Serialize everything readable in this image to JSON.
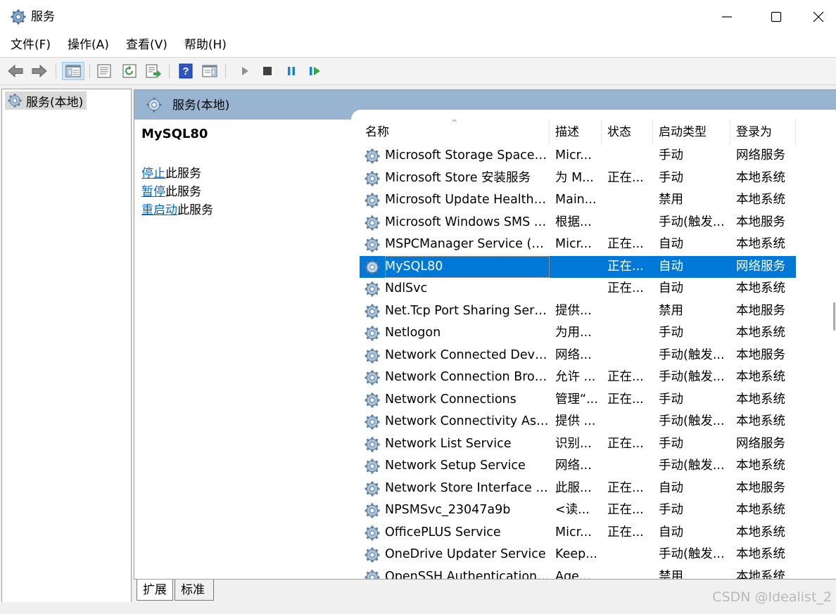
{
  "window": {
    "title": "服务"
  },
  "menu": [
    {
      "label": "文件(F)"
    },
    {
      "label": "操作(A)"
    },
    {
      "label": "查看(V)"
    },
    {
      "label": "帮助(H)"
    }
  ],
  "tree": {
    "item": "服务(本地)"
  },
  "pane": {
    "header": "服务(本地)"
  },
  "details": {
    "service_name": "MySQL80",
    "actions": [
      {
        "link": "停止",
        "rest": "此服务"
      },
      {
        "link": "暂停",
        "rest": "此服务"
      },
      {
        "link": "重启动",
        "rest": "此服务"
      }
    ]
  },
  "columns": {
    "name": "名称",
    "description": "描述",
    "status": "状态",
    "startup": "启动类型",
    "logon": "登录为"
  },
  "sort_indicator": "^",
  "rows": [
    {
      "name": "Microsoft Storage Spaces S...",
      "description": "Micr...",
      "status": "",
      "startup": "手动",
      "logon": "网络服务"
    },
    {
      "name": "Microsoft Store 安装服务",
      "description": "为 M...",
      "status": "正在...",
      "startup": "手动",
      "logon": "本地系统"
    },
    {
      "name": "Microsoft Update Health S...",
      "description": "Main...",
      "status": "",
      "startup": "禁用",
      "logon": "本地系统"
    },
    {
      "name": "Microsoft Windows SMS 路...",
      "description": "根据...",
      "status": "",
      "startup": "手动(触发...",
      "logon": "本地服务"
    },
    {
      "name": "MSPCManager Service (St...",
      "description": "Micr...",
      "status": "正在...",
      "startup": "自动",
      "logon": "本地系统"
    },
    {
      "name": "MySQL80",
      "description": "",
      "status": "正在...",
      "startup": "自动",
      "logon": "网络服务",
      "selected": true
    },
    {
      "name": "NdlSvc",
      "description": "",
      "status": "正在...",
      "startup": "自动",
      "logon": "本地系统"
    },
    {
      "name": "Net.Tcp Port Sharing Service",
      "description": "提供...",
      "status": "",
      "startup": "禁用",
      "logon": "本地服务"
    },
    {
      "name": "Netlogon",
      "description": "为用...",
      "status": "",
      "startup": "手动",
      "logon": "本地系统"
    },
    {
      "name": "Network Connected Devic...",
      "description": "网络...",
      "status": "",
      "startup": "手动(触发...",
      "logon": "本地服务"
    },
    {
      "name": "Network Connection Broker",
      "description": "允许 ...",
      "status": "正在...",
      "startup": "手动(触发...",
      "logon": "本地系统"
    },
    {
      "name": "Network Connections",
      "description": "管理“...",
      "status": "正在...",
      "startup": "手动",
      "logon": "本地系统"
    },
    {
      "name": "Network Connectivity Assis...",
      "description": "提供 ...",
      "status": "",
      "startup": "手动(触发...",
      "logon": "本地系统"
    },
    {
      "name": "Network List Service",
      "description": "识别...",
      "status": "正在...",
      "startup": "手动",
      "logon": "网络服务"
    },
    {
      "name": "Network Setup Service",
      "description": "网络...",
      "status": "",
      "startup": "手动(触发...",
      "logon": "本地系统"
    },
    {
      "name": "Network Store Interface Se...",
      "description": "此服...",
      "status": "正在...",
      "startup": "自动",
      "logon": "本地服务"
    },
    {
      "name": "NPSMSvc_23047a9b",
      "description": "<读...",
      "status": "正在...",
      "startup": "手动",
      "logon": "本地系统"
    },
    {
      "name": "OfficePLUS Service",
      "description": "Micr...",
      "status": "正在...",
      "startup": "自动",
      "logon": "本地系统"
    },
    {
      "name": "OneDrive Updater Service",
      "description": "Keep...",
      "status": "",
      "startup": "手动(触发...",
      "logon": "本地系统"
    },
    {
      "name": "OpenSSH Authentication ...",
      "description": "Age...",
      "status": "",
      "startup": "禁用",
      "logon": "本地系统"
    }
  ],
  "tabs": [
    {
      "label": "扩展",
      "active": true
    },
    {
      "label": "标准",
      "active": false
    }
  ],
  "watermark": "CSDN @Idealist_2",
  "colors": {
    "selection": "#0078d7",
    "pane_header": "#99b4d1",
    "link": "#0066cc"
  },
  "icons": {
    "app": "gear-icon",
    "toolbar": [
      "back-arrow-icon",
      "forward-arrow-icon",
      "console-tree-icon",
      "properties-icon",
      "refresh-icon",
      "export-list-icon",
      "help-icon",
      "show-pane-icon",
      "start-icon",
      "stop-icon",
      "pause-icon",
      "restart-icon"
    ]
  }
}
